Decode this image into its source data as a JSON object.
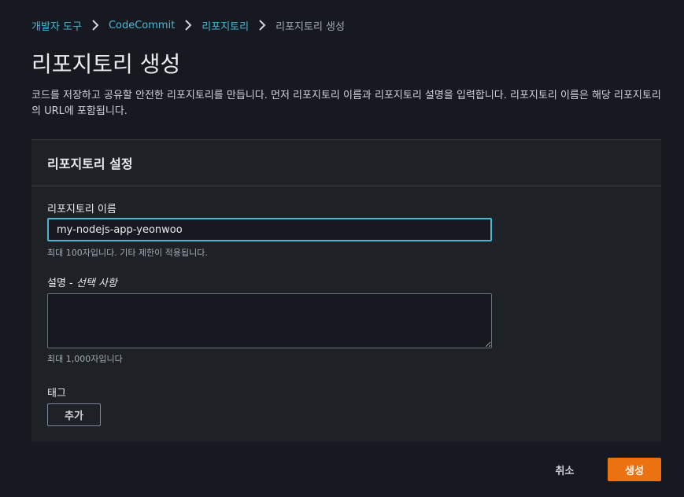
{
  "breadcrumb": {
    "items": [
      {
        "label": "개발자 도구"
      },
      {
        "label": "CodeCommit"
      },
      {
        "label": "리포지토리"
      },
      {
        "label": "리포지토리 생성"
      }
    ],
    "separator_icon": "chevron-right-icon"
  },
  "page": {
    "title": "리포지토리 생성",
    "description": "코드를 저장하고 공유할 안전한 리포지토리를 만듭니다. 먼저 리포지토리 이름과 리포지토리 설명을 입력합니다. 리포지토리 이름은 해당 리포지토리의 URL에 포함됩니다."
  },
  "settings_panel": {
    "title": "리포지토리 설정",
    "name_field": {
      "label": "리포지토리 이름",
      "value": "my-nodejs-app-yeonwoo",
      "hint": "최대 100자입니다. 기타 제한이 적용됩니다."
    },
    "description_field": {
      "label": "설명",
      "label_separator": " - ",
      "optional_text": "선택 사항",
      "value": "",
      "hint": "최대 1,000자입니다"
    },
    "tags": {
      "label": "태그",
      "add_button_label": "추가"
    }
  },
  "actions": {
    "cancel_label": "취소",
    "create_label": "생성"
  },
  "colors": {
    "background": "#16191f",
    "panel": "#1e2227",
    "link": "#44b9d6",
    "focus_border": "#44b9d6",
    "primary_button": "#ec7211"
  }
}
